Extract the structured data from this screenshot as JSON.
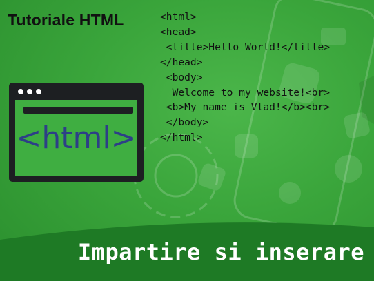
{
  "title": "Tutoriale HTML",
  "code_lines": [
    "<html>",
    "<head>",
    " <title>Hello World!</title>",
    "</head>",
    " <body>",
    "  Welcome to my website!<br>",
    " <b>My name is Vlad!</b><br>",
    " </body>",
    "</html>"
  ],
  "browser_icon": {
    "icon": "browser-window-icon",
    "label": "<html>"
  },
  "footer": {
    "text": "Impartire si inserare"
  },
  "colors": {
    "background": "#3aa53b",
    "window": "#1d1f22",
    "tag_text": "#2d3f87",
    "footer_band": "#1e7a25",
    "footer_text": "#ffffff"
  }
}
